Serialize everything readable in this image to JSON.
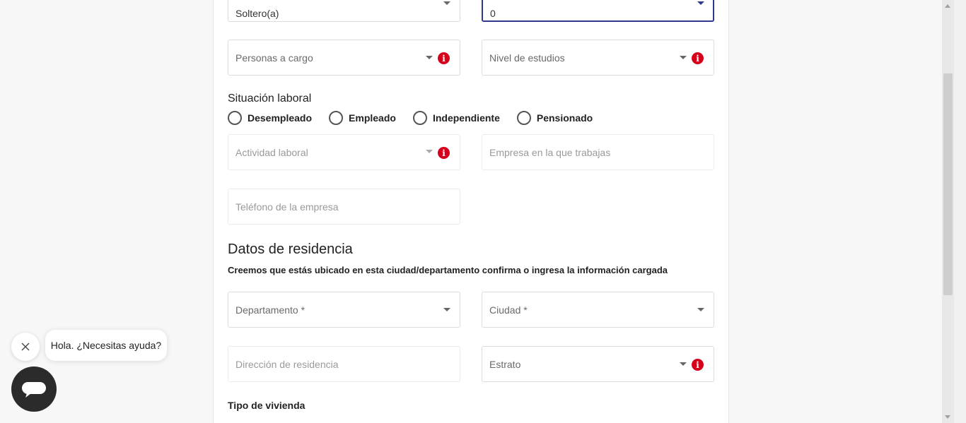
{
  "form": {
    "marital_status": {
      "value": "Soltero(a)"
    },
    "children": {
      "value": "0"
    },
    "dependents": {
      "placeholder": "Personas a cargo"
    },
    "education": {
      "placeholder": "Nivel de estudios"
    },
    "employment": {
      "title": "Situación laboral",
      "options": [
        "Desempleado",
        "Empleado",
        "Independiente",
        "Pensionado"
      ]
    },
    "activity": {
      "placeholder": "Actividad laboral"
    },
    "company": {
      "placeholder": "Empresa en la que trabajas"
    },
    "company_phone": {
      "placeholder": "Teléfono de la empresa"
    },
    "residence": {
      "title": "Datos de residencia",
      "note": "Creemos que estás ubicado en esta ciudad/departamento confirma o ingresa la información cargada",
      "department": {
        "placeholder": "Departamento *"
      },
      "city": {
        "placeholder": "Ciudad *"
      },
      "address": {
        "placeholder": "Dirección de residencia"
      },
      "stratum": {
        "placeholder": "Estrato"
      },
      "housing_type_label": "Tipo de vivienda"
    }
  },
  "chat": {
    "greeting": "Hola. ¿Necesitas ayuda?",
    "close_icon": "close-icon",
    "chat_icon": "chat-icon"
  },
  "colors": {
    "info_red": "#d6001c",
    "focus_blue": "#2f3a8f"
  }
}
